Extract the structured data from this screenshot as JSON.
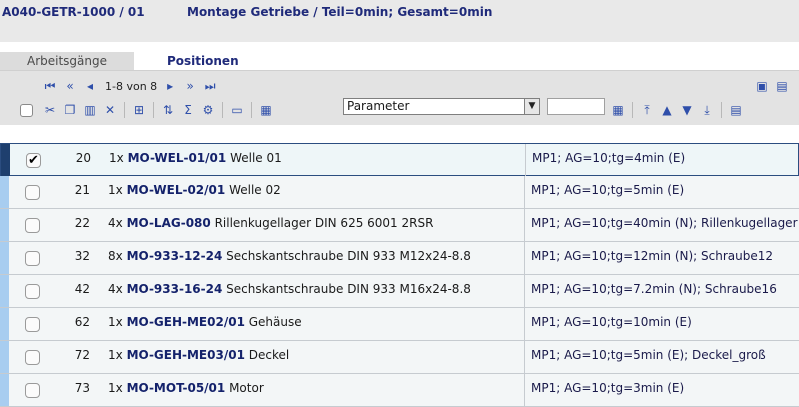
{
  "header": {
    "code": "A040-GETR-1000 / 01",
    "description": "Montage Getriebe / Teil=0min; Gesamt=0min"
  },
  "tabs": [
    {
      "label": "Arbeitsgänge",
      "active": false
    },
    {
      "label": "Positionen",
      "active": true
    }
  ],
  "toolbar": {
    "pager_text": "1-8 von 8",
    "param_select_value": "Parameter",
    "param_field_value": ""
  },
  "rows": [
    {
      "pos": "20",
      "qty": "1x",
      "code": "MO-WEL-01/01",
      "name": "Welle 01",
      "param": "MP1; AG=10;tg=4min (E)",
      "checked": true
    },
    {
      "pos": "21",
      "qty": "1x",
      "code": "MO-WEL-02/01",
      "name": "Welle 02",
      "param": "MP1; AG=10;tg=5min (E)",
      "checked": false
    },
    {
      "pos": "22",
      "qty": "4x",
      "code": "MO-LAG-080",
      "name": "Rillenkugellager DIN 625 6001 2RSR",
      "param": "MP1; AG=10;tg=40min (N); Rillenkugellager",
      "checked": false
    },
    {
      "pos": "32",
      "qty": "8x",
      "code": "MO-933-12-24",
      "name": "Sechskantschraube DIN 933 M12x24-8.8",
      "param": "MP1; AG=10;tg=12min (N); Schraube12",
      "checked": false
    },
    {
      "pos": "42",
      "qty": "4x",
      "code": "MO-933-16-24",
      "name": "Sechskantschraube DIN 933 M16x24-8.8",
      "param": "MP1; AG=10;tg=7.2min (N); Schraube16",
      "checked": false
    },
    {
      "pos": "62",
      "qty": "1x",
      "code": "MO-GEH-ME02/01",
      "name": "Gehäuse",
      "param": "MP1; AG=10;tg=10min (E)",
      "checked": false
    },
    {
      "pos": "72",
      "qty": "1x",
      "code": "MO-GEH-ME03/01",
      "name": "Deckel",
      "param": "MP1; AG=10;tg=5min (E); Deckel_groß",
      "checked": false
    },
    {
      "pos": "73",
      "qty": "1x",
      "code": "MO-MOT-05/01",
      "name": "Motor",
      "param": "MP1; AG=10;tg=3min (E)",
      "checked": false
    }
  ]
}
